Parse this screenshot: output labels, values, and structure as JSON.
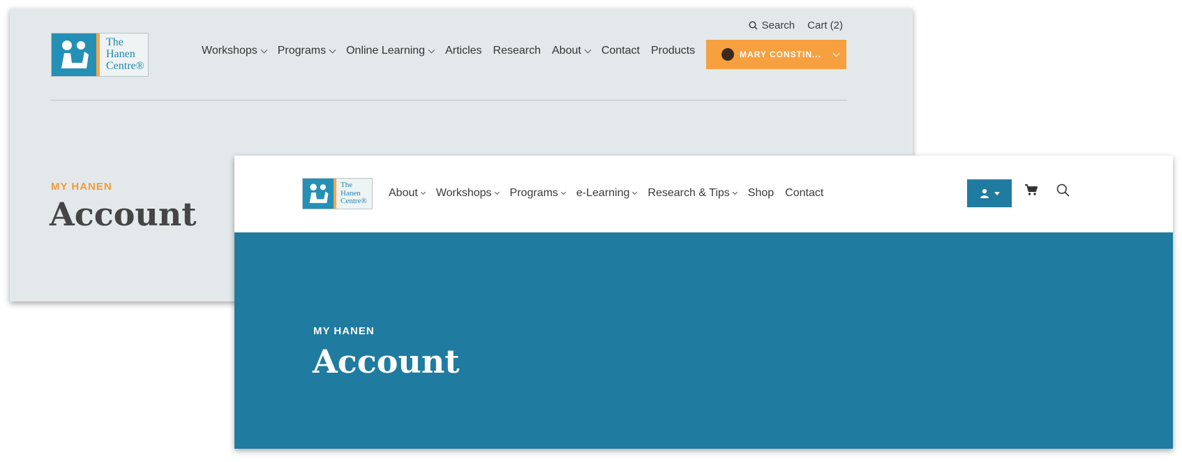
{
  "old_design": {
    "logo": {
      "line1": "The",
      "line2": "Hanen",
      "line3": "Centre®"
    },
    "utility": {
      "search_label": "Search",
      "cart_label": "Cart (2)"
    },
    "nav": [
      {
        "label": "Workshops",
        "dropdown": true
      },
      {
        "label": "Programs",
        "dropdown": true
      },
      {
        "label": "Online Learning",
        "dropdown": true
      },
      {
        "label": "Articles",
        "dropdown": false
      },
      {
        "label": "Research",
        "dropdown": false
      },
      {
        "label": "About",
        "dropdown": true
      },
      {
        "label": "Contact",
        "dropdown": false
      },
      {
        "label": "Products",
        "dropdown": false
      }
    ],
    "user_button": {
      "label": "MARY CONSTIN..."
    },
    "eyebrow": "MY HANEN",
    "title": "Account",
    "colors": {
      "background": "#e3e9ea",
      "accent": "#f7a040"
    }
  },
  "new_design": {
    "logo": {
      "line1": "The",
      "line2": "Hanen",
      "line3": "Centre®"
    },
    "nav": [
      {
        "label": "About",
        "dropdown": true
      },
      {
        "label": "Workshops",
        "dropdown": true
      },
      {
        "label": "Programs",
        "dropdown": true
      },
      {
        "label": "e-Learning",
        "dropdown": true
      },
      {
        "label": "Research & Tips",
        "dropdown": true
      },
      {
        "label": "Shop",
        "dropdown": false
      },
      {
        "label": "Contact",
        "dropdown": false
      }
    ],
    "icons": [
      "user-icon",
      "cart-icon",
      "search-icon"
    ],
    "eyebrow": "MY HANEN",
    "title": "Account",
    "colors": {
      "hero": "#1f7ba0",
      "header": "#ffffff"
    }
  }
}
